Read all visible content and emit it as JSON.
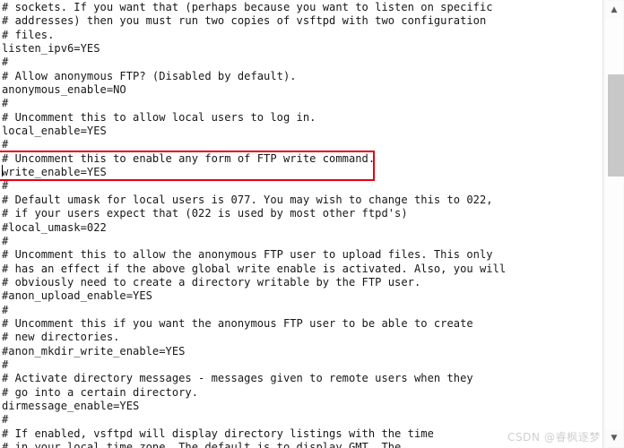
{
  "window": {
    "app_type": "text-editor",
    "file_type": "vsftpd configuration file"
  },
  "editor": {
    "font_color": "#17171a",
    "background_color": "#ffffff",
    "lines": [
      "# sockets. If you want that (perhaps because you want to listen on specific",
      "# addresses) then you must run two copies of vsftpd with two configuration",
      "# files.",
      "listen_ipv6=YES",
      "#",
      "# Allow anonymous FTP? (Disabled by default).",
      "anonymous_enable=NO",
      "#",
      "# Uncomment this to allow local users to log in.",
      "local_enable=YES",
      "#",
      "# Uncomment this to enable any form of FTP write command.",
      "write_enable=YES",
      "#",
      "# Default umask for local users is 077. You may wish to change this to 022,",
      "# if your users expect that (022 is used by most other ftpd's)",
      "#local_umask=022",
      "#",
      "# Uncomment this to allow the anonymous FTP user to upload files. This only",
      "# has an effect if the above global write enable is activated. Also, you will",
      "# obviously need to create a directory writable by the FTP user.",
      "#anon_upload_enable=YES",
      "#",
      "# Uncomment this if you want the anonymous FTP user to be able to create",
      "# new directories.",
      "#anon_mkdir_write_enable=YES",
      "#",
      "# Activate directory messages - messages given to remote users when they",
      "# go into a certain directory.",
      "dirmessage_enable=YES",
      "#",
      "# If enabled, vsftpd will display directory listings with the time",
      "# in your local time zone. The default is to display GMT. The"
    ]
  },
  "annotation": {
    "color": "#e60012",
    "highlighted_lines": [
      "# Uncomment this to enable any form of FTP write command.",
      "write_enable=YES"
    ]
  },
  "scrollbar": {
    "up_arrow_glyph": "▲",
    "down_arrow_glyph": "▼",
    "thumb_color": "#c8c8c8",
    "track_color": "#fdfdfd"
  },
  "watermark": {
    "text": "CSDN @睿枫逐梦"
  }
}
